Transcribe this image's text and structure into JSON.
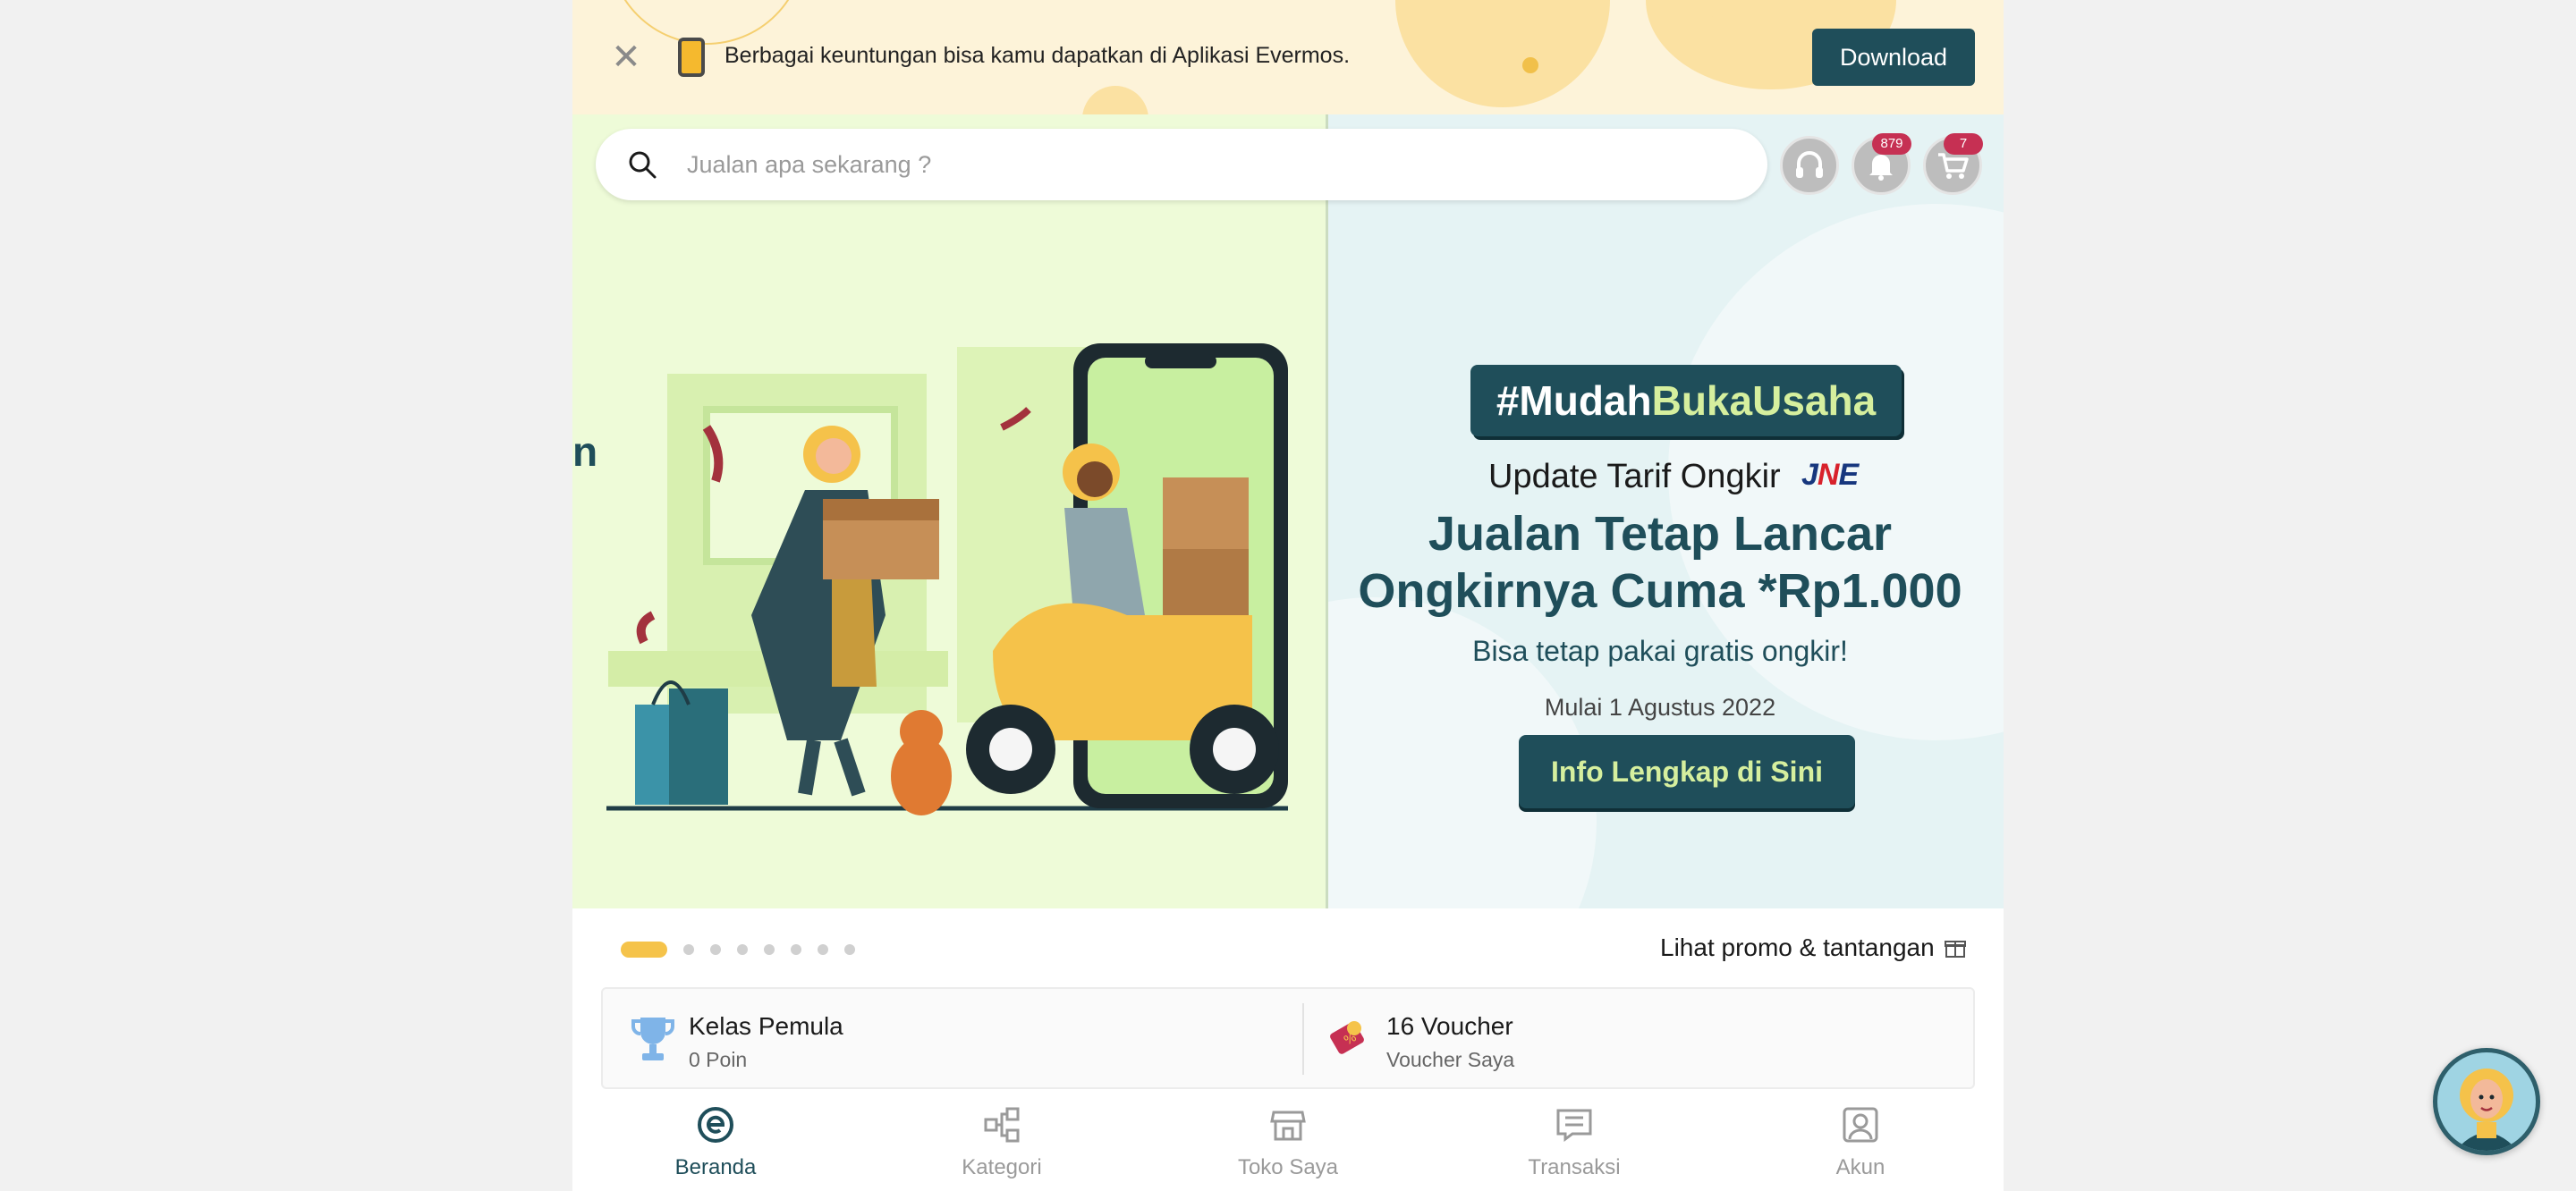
{
  "banner": {
    "close_icon": "close-icon",
    "app_icon": "phone-icon",
    "text": "Berbagai keuntungan bisa kamu dapatkan di Aplikasi Evermos.",
    "download_label": "Download"
  },
  "search": {
    "placeholder": "Jualan apa sekarang ?",
    "value": ""
  },
  "header_icons": {
    "support_icon": "headset-icon",
    "notification_icon": "bell-icon",
    "notification_count": "879",
    "cart_icon": "cart-icon",
    "cart_count": "7"
  },
  "hero": {
    "tag_part1": "#Mudah",
    "tag_part2": "BukaUsaha",
    "update_text": "Update Tarif Ongkir",
    "courier_logo": "JNE",
    "headline_line1": "Jualan Tetap Lancar",
    "headline_line2": "Ongkirnya Cuma *Rp1.000",
    "subtitle": "Bisa tetap pakai gratis ongkir!",
    "date": "Mulai 1 Agustus 2022",
    "cta_label": "Info Lengkap di Sini",
    "left_edge_text": "n",
    "colors": {
      "primary": "#1f4e5a",
      "accent": "#d6ef9e"
    }
  },
  "carousel": {
    "total": 8,
    "active_index": 0
  },
  "promo_link": {
    "label": "Lihat promo & tantangan",
    "icon": "gift-icon"
  },
  "info_card": {
    "level_icon": "trophy-icon",
    "level_title": "Kelas Pemula",
    "level_points": "0 Poin",
    "voucher_icon": "voucher-icon",
    "voucher_title": "16 Voucher",
    "voucher_sub": "Voucher Saya"
  },
  "bottom_nav": {
    "items": [
      {
        "label": "Beranda",
        "icon": "evermos-home-icon",
        "active": true
      },
      {
        "label": "Kategori",
        "icon": "category-icon",
        "active": false
      },
      {
        "label": "Toko Saya",
        "icon": "store-icon",
        "active": false
      },
      {
        "label": "Transaksi",
        "icon": "transaction-icon",
        "active": false
      },
      {
        "label": "Akun",
        "icon": "account-icon",
        "active": false
      }
    ]
  },
  "assistant": {
    "icon": "assistant-avatar-icon"
  }
}
